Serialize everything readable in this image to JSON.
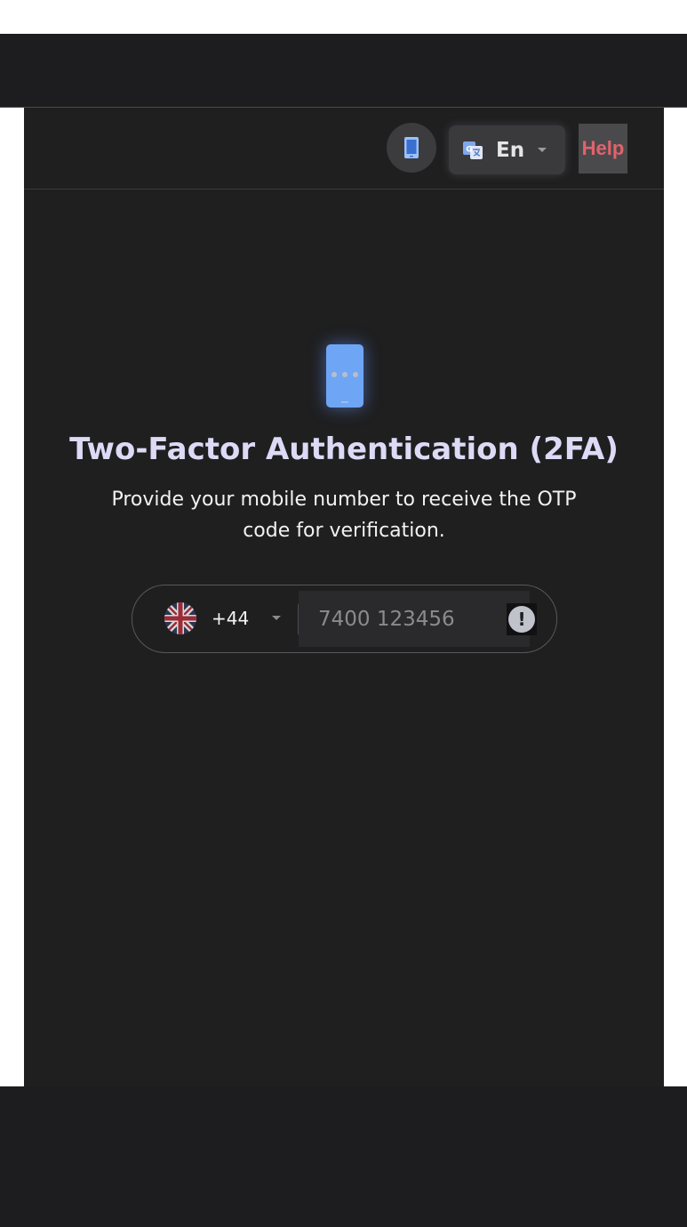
{
  "header": {
    "language_label": "En",
    "help_label": "Help",
    "icons": {
      "device": "mobile-icon",
      "translate": "translate-icon",
      "dropdown": "chevron-down-icon"
    }
  },
  "main": {
    "title": "Two-Factor Authentication (2FA)",
    "subtitle": "Provide your mobile number to receive the OTP code for verification.",
    "phone": {
      "country_flag": "uk-flag-icon",
      "country_code": "+44",
      "placeholder": "7400 123456",
      "value": "",
      "alert_symbol": "!"
    }
  },
  "colors": {
    "background": "#1f1f20",
    "accent_blue": "#6fa5f5",
    "title": "#dcdaf5",
    "help": "#e2636b"
  }
}
